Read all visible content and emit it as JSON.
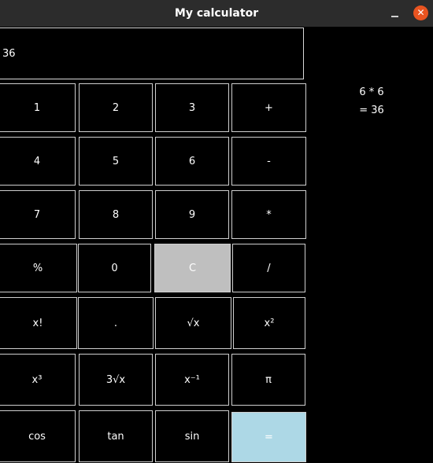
{
  "window": {
    "title": "My calculator",
    "minimize_icon": "minimize-icon",
    "close_icon": "close-icon",
    "close_glyph": "✕",
    "close_color": "#e95420"
  },
  "display": {
    "value": "36"
  },
  "history": {
    "lines": [
      "6 * 6",
      "= 36"
    ]
  },
  "buttons": {
    "one": "1",
    "two": "2",
    "three": "3",
    "plus": "+",
    "four": "4",
    "five": "5",
    "six": "6",
    "minus": "-",
    "seven": "7",
    "eight": "8",
    "nine": "9",
    "multiply": "*",
    "percent": "%",
    "zero": "0",
    "clear": "C",
    "divide": "/",
    "factorial": "x!",
    "decimal": ".",
    "sqrt": "√x",
    "square": "x²",
    "cube": "x³",
    "cube_root": "3√x",
    "inverse": "x⁻¹",
    "pi": "π",
    "cos": "cos",
    "tan": "tan",
    "sin": "sin",
    "equals": "="
  },
  "colors": {
    "background": "#000000",
    "titlebar": "#2c2c2c",
    "clear_button": "#bfbfbf",
    "equals_button": "#add8e6"
  }
}
